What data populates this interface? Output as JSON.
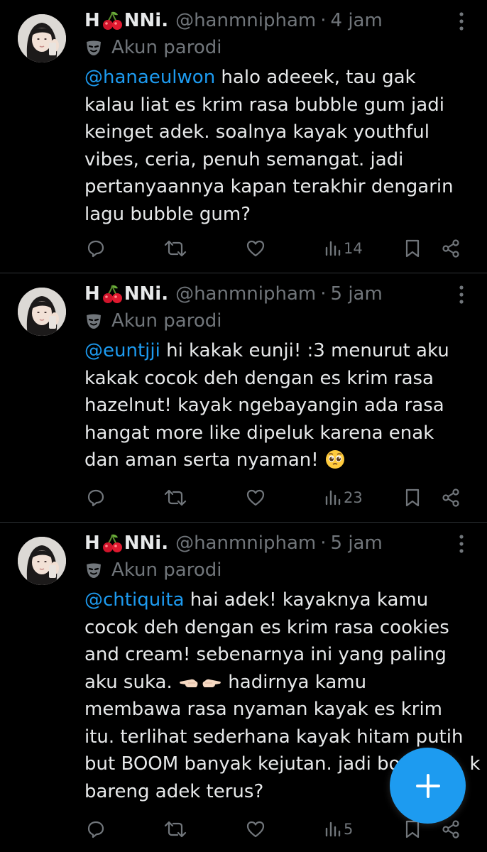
{
  "colors": {
    "background": "#000000",
    "text": "#e7e9ea",
    "muted": "#71767b",
    "accent": "#1d9bf0",
    "divider": "#2f3336"
  },
  "tweets": [
    {
      "display_name_prefix": "H",
      "display_name_emoji": "cherries",
      "display_name_suffix": "NNi.",
      "handle": "@hanmnipham",
      "separator": "·",
      "time": "4 jam",
      "label_icon": "theater-mask-icon",
      "label": "Akun parodi",
      "mention": "@hanaeulwon",
      "lines": [
        " halo adeeek, tau gak",
        "kalau liat es krim rasa bubble gum jadi",
        "keinget adek. soalnya kayak youthful",
        "vibes, ceria, penuh semangat. jadi",
        "pertanyaannya kapan terakhir dengarin",
        "lagu bubble gum?"
      ],
      "views": "14"
    },
    {
      "display_name_prefix": "H",
      "display_name_emoji": "cherries",
      "display_name_suffix": "NNi.",
      "handle": "@hanmnipham",
      "separator": "·",
      "time": "5 jam",
      "label_icon": "theater-mask-icon",
      "label": "Akun parodi",
      "mention": "@euntjji",
      "lines": [
        " hi kakak eunji! :3 menurut aku",
        "kakak cocok deh dengan es krim rasa",
        "hazelnut! kayak ngebayangin ada rasa",
        "hangat more like dipeluk karena enak",
        "dan aman serta nyaman! "
      ],
      "emoji_end": "pleading-face",
      "views": "23"
    },
    {
      "display_name_prefix": "H",
      "display_name_emoji": "cherries",
      "display_name_suffix": "NNi.",
      "handle": "@hanmnipham",
      "separator": "·",
      "time": "5 jam",
      "label_icon": "theater-mask-icon",
      "label": "Akun parodi",
      "mention": "@chtiquita",
      "lines": [
        " hai adek! kayaknya kamu",
        "cocok deh dengan es krim rasa cookies",
        "and cream! sebenarnya ini yang paling",
        "aku suka. ",
        "membawa rasa nyaman kayak es krim",
        "itu. terlihat sederhana kayak hitam putih",
        "but BOOM banyak kejutan. jadi bo",
        "bareng adek terus?"
      ],
      "line4_after_emoji": " hadirnya kamu",
      "line4_emoji": "pointing-fingers",
      "line7_tail": "k",
      "views": "5"
    }
  ],
  "fab": {
    "icon": "plus-icon",
    "label": "+"
  }
}
